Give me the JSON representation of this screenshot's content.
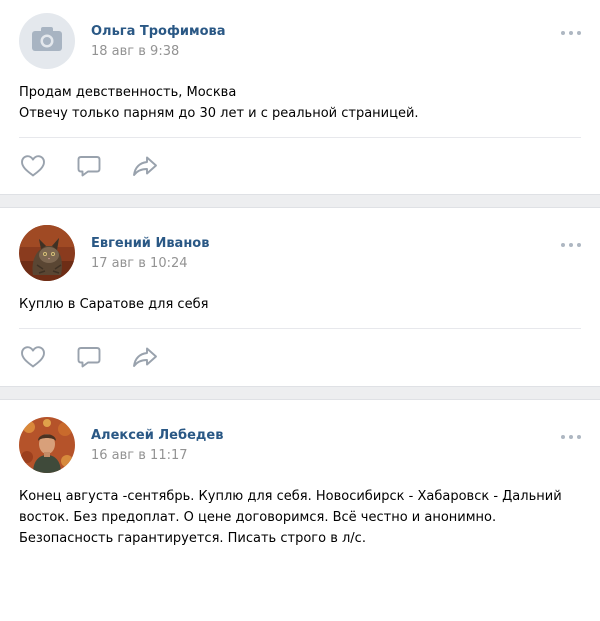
{
  "colors": {
    "author_link": "#2a5885",
    "date_text": "#939393",
    "icon_gray": "#99a2ad",
    "page_gap": "#edeef0",
    "divider": "#e7e8ec"
  },
  "posts": [
    {
      "author": "Ольга Трофимова",
      "date": "18 авг в 9:38",
      "avatar": "camera-placeholder-icon",
      "text_lines": [
        "Продам девственность, Москва",
        "Отвечу только парням до 30 лет и с реальной страницей."
      ],
      "actions": [
        "like-icon",
        "comment-icon",
        "share-icon"
      ],
      "menu_icon": "more-icon"
    },
    {
      "author": "Евгений Иванов",
      "date": "17 авг в 10:24",
      "avatar": "cat-photo",
      "text_lines": [
        "Куплю в Саратове для себя"
      ],
      "actions": [
        "like-icon",
        "comment-icon",
        "share-icon"
      ],
      "menu_icon": "more-icon"
    },
    {
      "author": "Алексей Лебедев",
      "date": "16 авг в 11:17",
      "avatar": "person-photo",
      "text_lines": [
        "Конец августа -сентябрь. Куплю для себя. Новосибирск - Хабаровск - Дальний",
        "восток. Без предоплат. О цене договоримся. Всё честно и анонимно.",
        "Безопасность гарантируется. Писать строго в л/с."
      ],
      "menu_icon": "more-icon"
    }
  ]
}
